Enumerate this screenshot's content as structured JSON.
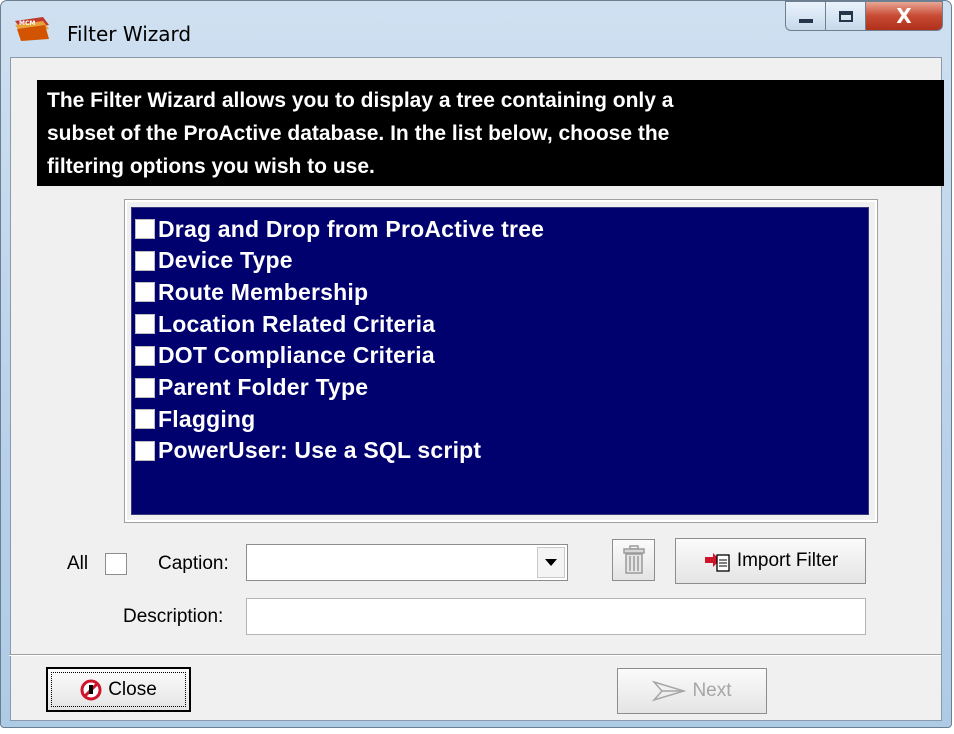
{
  "window": {
    "title": "Filter Wizard",
    "app_icon": "mcm-app-icon",
    "controls": {
      "minimize": "minimize-icon",
      "maximize": "maximize-icon",
      "close_glyph": "X"
    }
  },
  "banner": {
    "lines": [
      "The Filter Wizard allows you to display a tree containing only a",
      "subset of the ProActive database. In the list below, choose the",
      "filtering options you wish to use."
    ]
  },
  "filter_options": [
    {
      "label": "Drag and Drop from ProActive tree",
      "checked": false
    },
    {
      "label": "Device Type",
      "checked": false
    },
    {
      "label": "Route Membership",
      "checked": false
    },
    {
      "label": "Location Related Criteria",
      "checked": false
    },
    {
      "label": "DOT Compliance Criteria",
      "checked": false
    },
    {
      "label": "Parent Folder Type",
      "checked": false
    },
    {
      "label": "Flagging",
      "checked": false
    },
    {
      "label": "PowerUser: Use a SQL script",
      "checked": false
    }
  ],
  "controls": {
    "all_label": "All",
    "all_checked": false,
    "caption_label": "Caption:",
    "caption_value": "",
    "description_label": "Description:",
    "description_value": "",
    "import_filter_label": "Import Filter",
    "trash_icon": "trash-icon"
  },
  "footer": {
    "close_label": "Close",
    "next_label": "Next",
    "next_enabled": false
  },
  "colors": {
    "listbox_bg": "#00006e",
    "banner_bg": "#000000",
    "disabled_text": "#a6a6a6"
  }
}
